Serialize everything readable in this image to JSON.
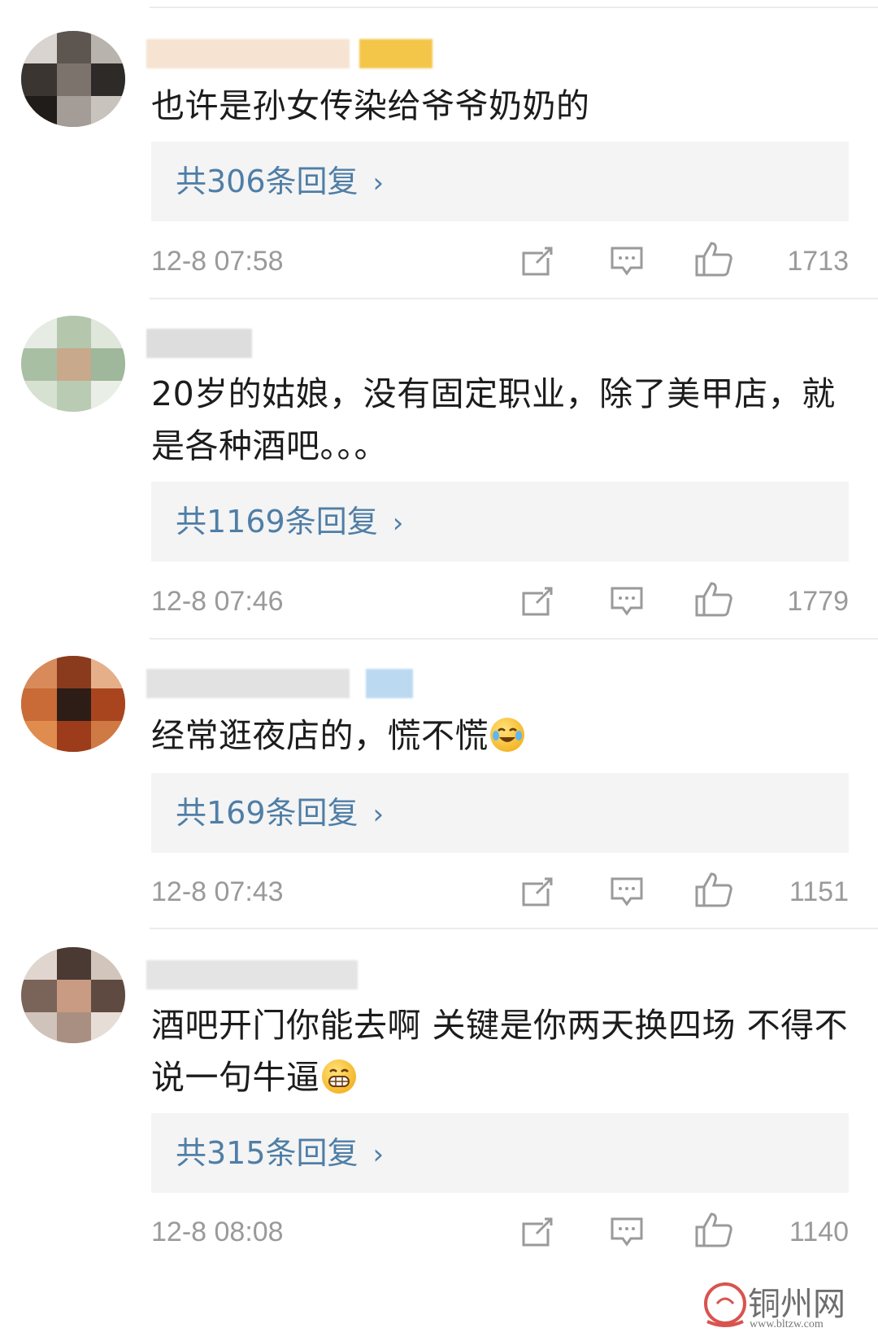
{
  "comments": [
    {
      "text": "也许是孙女传染给爷爷奶奶的",
      "reply_link": "共306条回复",
      "time": "12-8 07:58",
      "likes": "1713"
    },
    {
      "text": "20岁的姑娘，没有固定职业，除了美甲店，就是各种酒吧。。。",
      "reply_link": "共1169条回复",
      "time": "12-8 07:46",
      "likes": "1779"
    },
    {
      "text": "经常逛夜店的，慌不慌",
      "emoji": "laugh-cry-emoji",
      "reply_link": "共169条回复",
      "time": "12-8 07:43",
      "likes": "1151"
    },
    {
      "text": "酒吧开门你能去啊 关键是你两天换四场 不得不说一句牛逼",
      "emoji": "grin-emoji",
      "reply_link": "共315条回复",
      "time": "12-8 08:08",
      "likes": "1140"
    }
  ],
  "icons": {
    "forward": "forward-icon",
    "comment": "comment-icon",
    "like": "thumbs-up-icon",
    "chevron": "chevron-right-icon"
  },
  "colors": {
    "link": "#4f7ea6",
    "meta": "#9a9a9a",
    "reply_bg": "#f4f4f4"
  },
  "watermark": {
    "name": "铜州网",
    "url": "www.bltzw.com"
  }
}
